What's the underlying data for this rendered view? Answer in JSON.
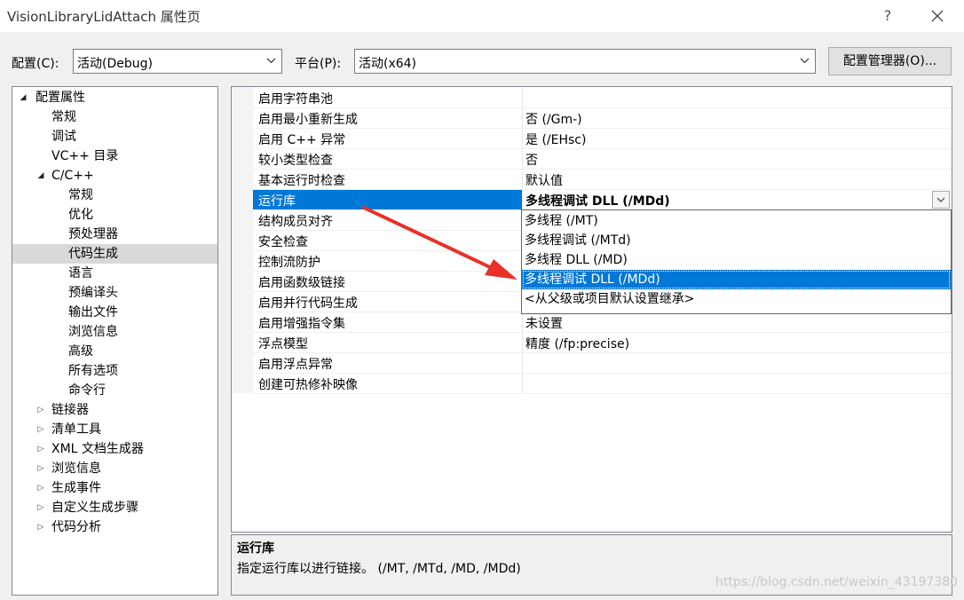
{
  "window": {
    "title": "VisionLibraryLidAttach 属性页",
    "help_label": "?"
  },
  "toolbar": {
    "config_label": "配置(C):",
    "config_value": "活动(Debug)",
    "platform_label": "平台(P):",
    "platform_value": "活动(x64)",
    "config_manager_label": "配置管理器(O)..."
  },
  "tree": {
    "items": [
      {
        "label": "配置属性",
        "arrow": "◢"
      },
      {
        "label": "常规",
        "arrow": ""
      },
      {
        "label": "调试",
        "arrow": ""
      },
      {
        "label": "VC++ 目录",
        "arrow": ""
      },
      {
        "label": "C/C++",
        "arrow": "◢"
      },
      {
        "label": "常规",
        "arrow": ""
      },
      {
        "label": "优化",
        "arrow": ""
      },
      {
        "label": "预处理器",
        "arrow": ""
      },
      {
        "label": "代码生成",
        "arrow": ""
      },
      {
        "label": "语言",
        "arrow": ""
      },
      {
        "label": "预编译头",
        "arrow": ""
      },
      {
        "label": "输出文件",
        "arrow": ""
      },
      {
        "label": "浏览信息",
        "arrow": ""
      },
      {
        "label": "高级",
        "arrow": ""
      },
      {
        "label": "所有选项",
        "arrow": ""
      },
      {
        "label": "命令行",
        "arrow": ""
      },
      {
        "label": "链接器",
        "arrow": "▷"
      },
      {
        "label": "清单工具",
        "arrow": "▷"
      },
      {
        "label": "XML 文档生成器",
        "arrow": "▷"
      },
      {
        "label": "浏览信息",
        "arrow": "▷"
      },
      {
        "label": "生成事件",
        "arrow": "▷"
      },
      {
        "label": "自定义生成步骤",
        "arrow": "▷"
      },
      {
        "label": "代码分析",
        "arrow": "▷"
      }
    ]
  },
  "properties": {
    "rows": [
      {
        "name": "启用字符串池",
        "value": ""
      },
      {
        "name": "启用最小重新生成",
        "value": "否 (/Gm-)"
      },
      {
        "name": "启用 C++ 异常",
        "value": "是 (/EHsc)"
      },
      {
        "name": "较小类型检查",
        "value": "否"
      },
      {
        "name": "基本运行时检查",
        "value": "默认值"
      },
      {
        "name": "运行库",
        "value": "多线程调试 DLL (/MDd)"
      },
      {
        "name": "结构成员对齐",
        "value": ""
      },
      {
        "name": "安全检查",
        "value": ""
      },
      {
        "name": "控制流防护",
        "value": ""
      },
      {
        "name": "启用函数级链接",
        "value": ""
      },
      {
        "name": "启用并行代码生成",
        "value": ""
      },
      {
        "name": "启用增强指令集",
        "value": "未设置"
      },
      {
        "name": "浮点模型",
        "value": "精度 (/fp:precise)"
      },
      {
        "name": "启用浮点异常",
        "value": ""
      },
      {
        "name": "创建可热修补映像",
        "value": ""
      }
    ]
  },
  "dropdown": {
    "options": [
      "多线程 (/MT)",
      "多线程调试 (/MTd)",
      "多线程 DLL (/MD)",
      "多线程调试 DLL (/MDd)",
      "<从父级或项目默认设置继承>"
    ]
  },
  "description": {
    "title": "运行库",
    "text": "指定运行库以进行链接。     (/MT, /MTd, /MD, /MDd)"
  },
  "watermark": "https://blog.csdn.net/weixin_43197380",
  "colors": {
    "selection": "#0078d7",
    "annotation_arrow": "#e8312a"
  }
}
